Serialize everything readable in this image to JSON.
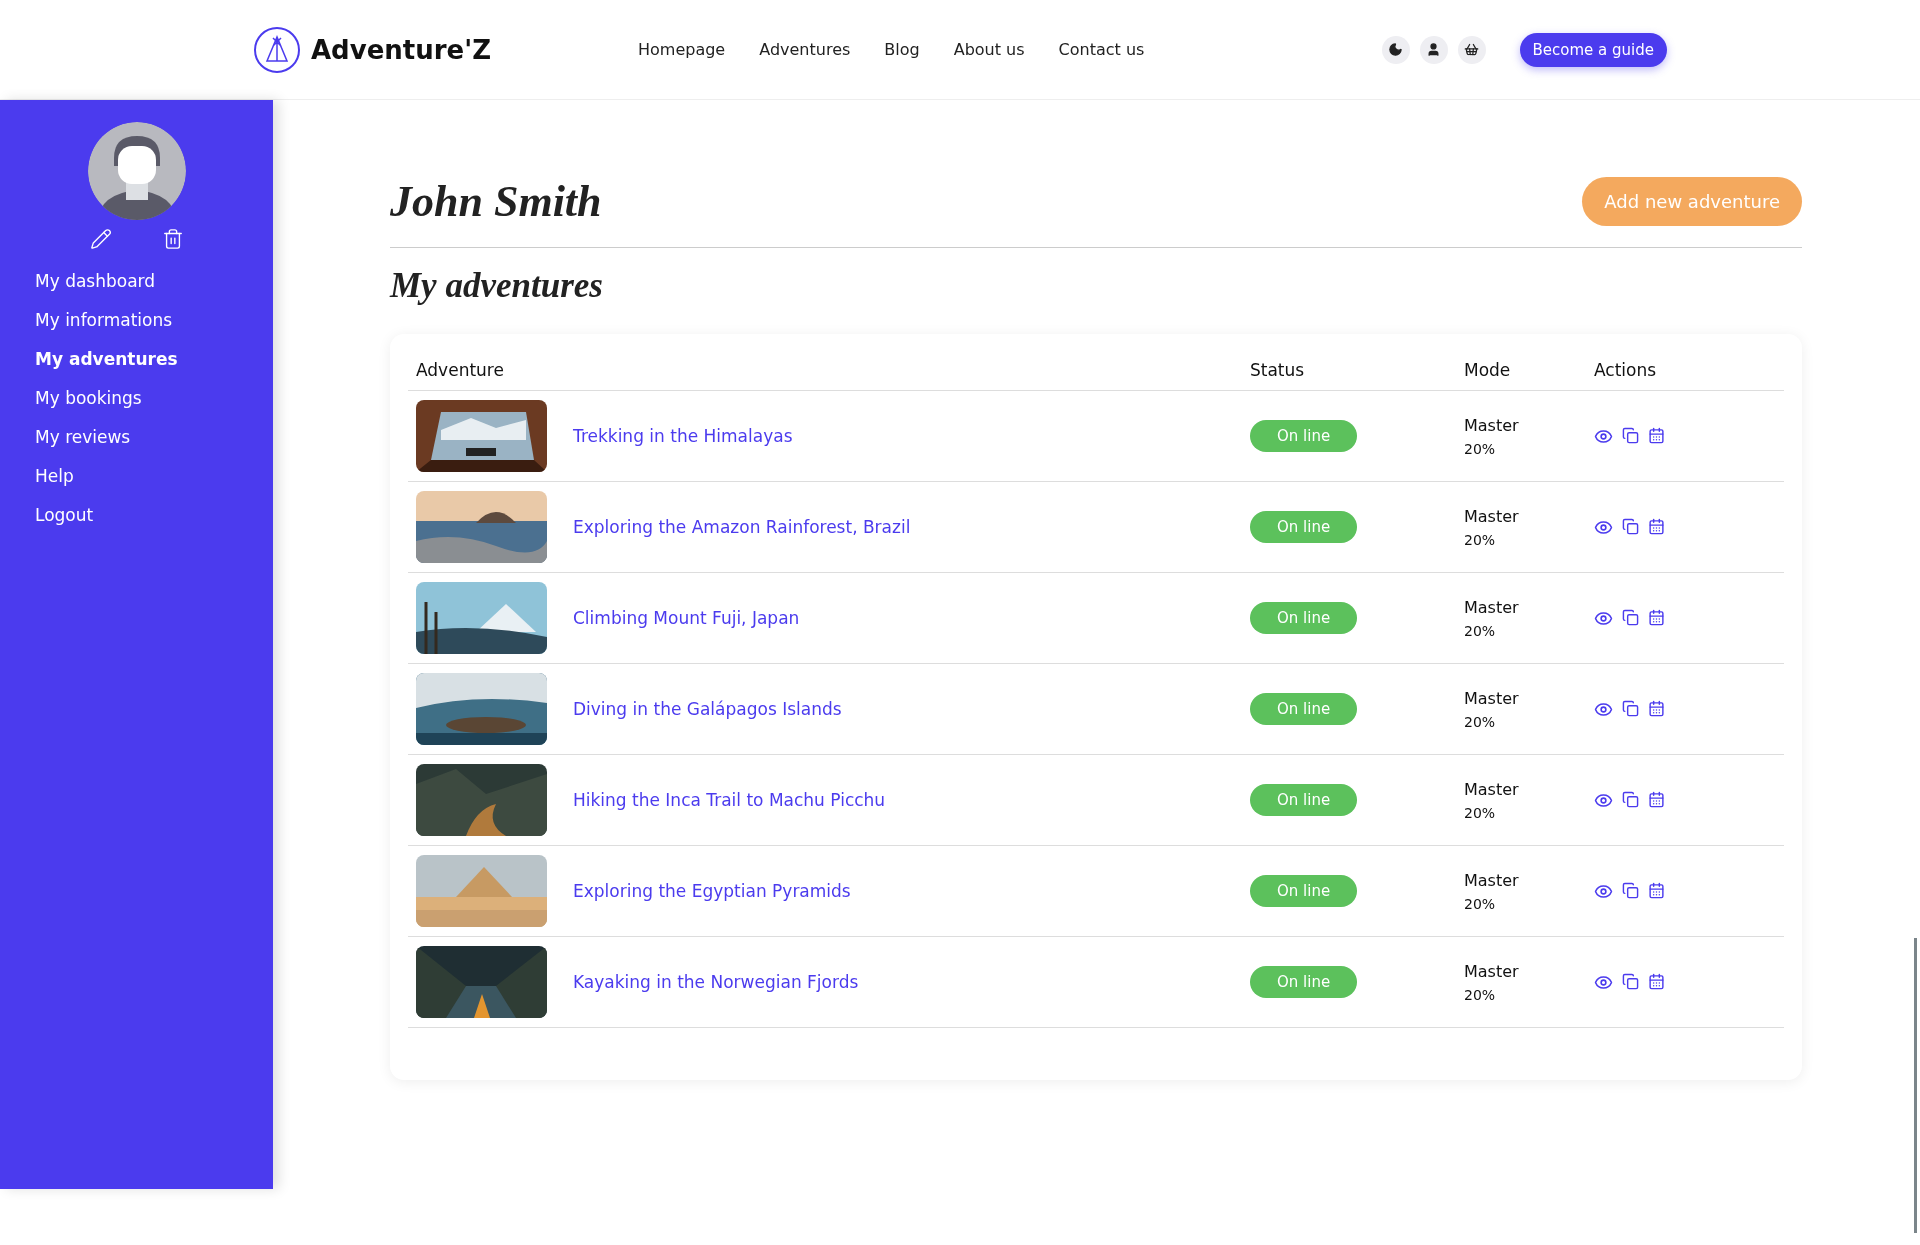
{
  "header": {
    "brand": "Adventure'Z",
    "nav": [
      {
        "label": "Homepage"
      },
      {
        "label": "Adventures"
      },
      {
        "label": "Blog"
      },
      {
        "label": "About us"
      },
      {
        "label": "Contact us"
      }
    ],
    "cta": "Become a guide"
  },
  "sidebar": {
    "items": [
      {
        "label": "My dashboard",
        "selected": false
      },
      {
        "label": "My informations",
        "selected": false
      },
      {
        "label": "My adventures",
        "selected": true
      },
      {
        "label": "My bookings",
        "selected": false
      },
      {
        "label": "My reviews",
        "selected": false
      },
      {
        "label": "Help",
        "selected": false
      },
      {
        "label": "Logout",
        "selected": false
      }
    ]
  },
  "page": {
    "title": "John Smith",
    "add_button": "Add new adventure",
    "section_title": "My adventures"
  },
  "table": {
    "columns": [
      "Adventure",
      "Status",
      "Mode",
      "Actions"
    ],
    "rows": [
      {
        "name": "Trekking in the Himalayas",
        "status": "On line",
        "mode": "Master",
        "share": "20%"
      },
      {
        "name": "Exploring the Amazon Rainforest, Brazil",
        "status": "On line",
        "mode": "Master",
        "share": "20%"
      },
      {
        "name": "Climbing Mount Fuji, Japan",
        "status": "On line",
        "mode": "Master",
        "share": "20%"
      },
      {
        "name": "Diving in the Galápagos Islands",
        "status": "On line",
        "mode": "Master",
        "share": "20%"
      },
      {
        "name": "Hiking the Inca Trail to Machu Picchu",
        "status": "On line",
        "mode": "Master",
        "share": "20%"
      },
      {
        "name": "Exploring the Egyptian Pyramids",
        "status": "On line",
        "mode": "Master",
        "share": "20%"
      },
      {
        "name": "Kayaking in the Norwegian Fjords",
        "status": "On line",
        "mode": "Master",
        "share": "20%"
      }
    ]
  }
}
